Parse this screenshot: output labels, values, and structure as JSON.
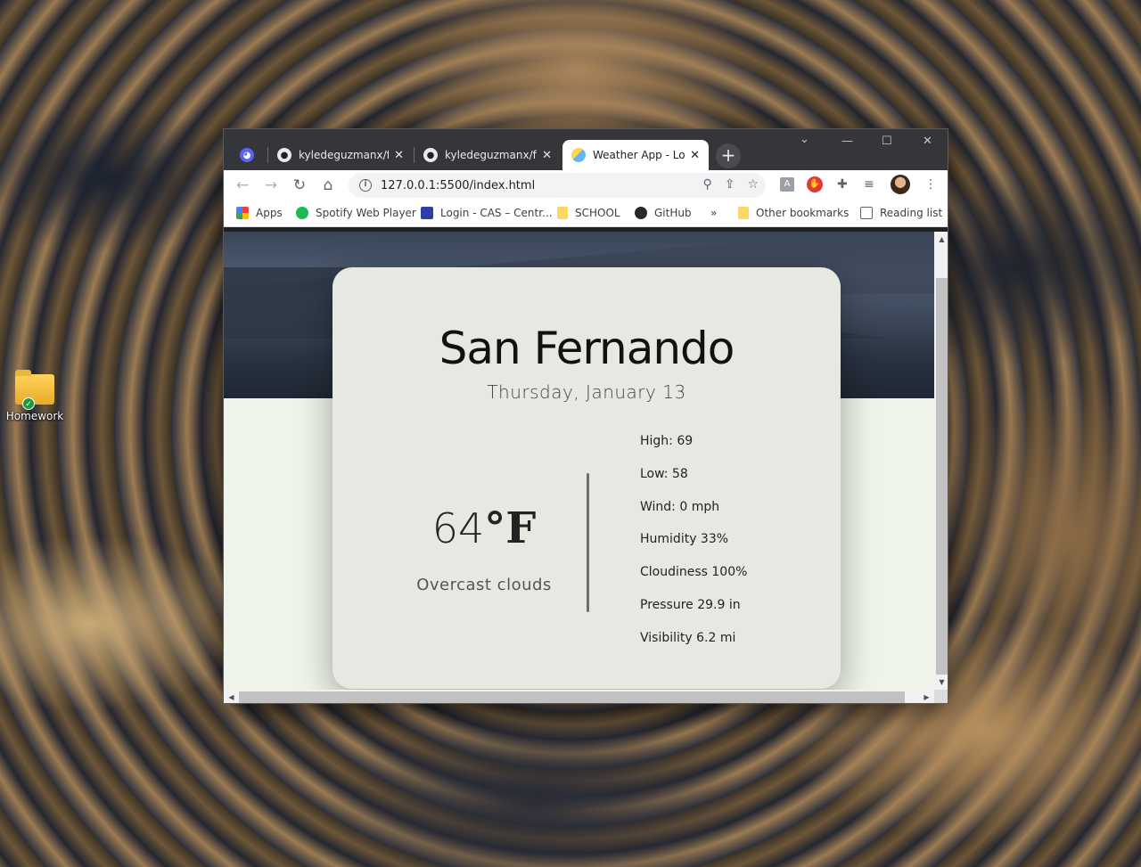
{
  "desktop": {
    "icon_label": "Homework"
  },
  "browser": {
    "tabs": [
      {
        "title": "",
        "icon": "discord-icon",
        "active": false
      },
      {
        "title": "kyledeguzmanx/fD",
        "icon": "github-icon",
        "active": false
      },
      {
        "title": "kyledeguzmanx/fD",
        "icon": "github-icon",
        "active": false
      },
      {
        "title": "Weather App - Los",
        "icon": "weather-icon",
        "active": true
      }
    ],
    "url": "127.0.0.1:5500/index.html",
    "bookmarks": [
      {
        "label": "Apps",
        "icon": "apps-grid-icon"
      },
      {
        "label": "Spotify Web Player",
        "icon": "spotify-icon"
      },
      {
        "label": "Login - CAS – Centr...",
        "icon": "cas-icon"
      },
      {
        "label": "SCHOOL",
        "icon": "folder-icon"
      },
      {
        "label": "GitHub",
        "icon": "github-icon"
      },
      {
        "label": "Other bookmarks",
        "icon": "folder-icon"
      },
      {
        "label": "Reading list",
        "icon": "reading-list-icon"
      }
    ],
    "overflow_label": "»"
  },
  "weather": {
    "city": "San Fernando",
    "date": "Thursday, January 13",
    "temperature": "64",
    "unit": "°F",
    "description": "Overcast clouds",
    "stats": [
      "High: 69",
      "Low: 58",
      "Wind: 0 mph",
      "Humidity 33%",
      "Cloudiness 100%",
      "Pressure 29.9 in",
      "Visibility 6.2 mi"
    ]
  }
}
